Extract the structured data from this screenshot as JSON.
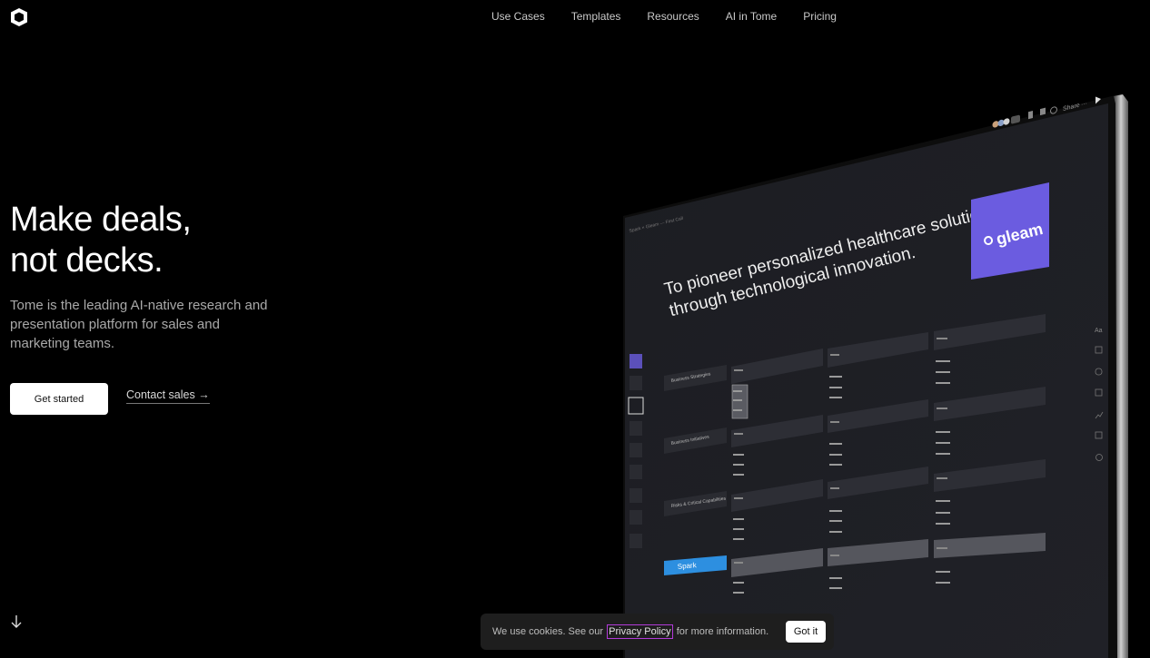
{
  "nav": {
    "items": [
      "Use Cases",
      "Templates",
      "Resources",
      "AI in Tome",
      "Pricing"
    ]
  },
  "hero": {
    "title_line1": "Make deals,",
    "title_line2": "not decks.",
    "subtitle": "Tome is the leading AI-native research and presentation platform for sales and marketing teams.",
    "cta_primary": "Get started",
    "cta_secondary": "Contact sales →"
  },
  "screen": {
    "breadcrumb": "Spark × Gleam — First Call",
    "share_label": "Share",
    "headline_line1": "To pioneer personalized healthcare solutions",
    "headline_line2": "through technological innovation.",
    "brand_card": "gleam",
    "rows": [
      "Business Strategies",
      "Business Initiatives",
      "Risks & Critical Capabilities",
      "Spark"
    ],
    "cell_label": "Lorem",
    "brand_color": "#6b5ce0",
    "spark_color": "#2d8fe0"
  },
  "cookie": {
    "text_before": "We use cookies. See our",
    "link": "Privacy Policy",
    "text_after": "for more information.",
    "button": "Got it"
  }
}
